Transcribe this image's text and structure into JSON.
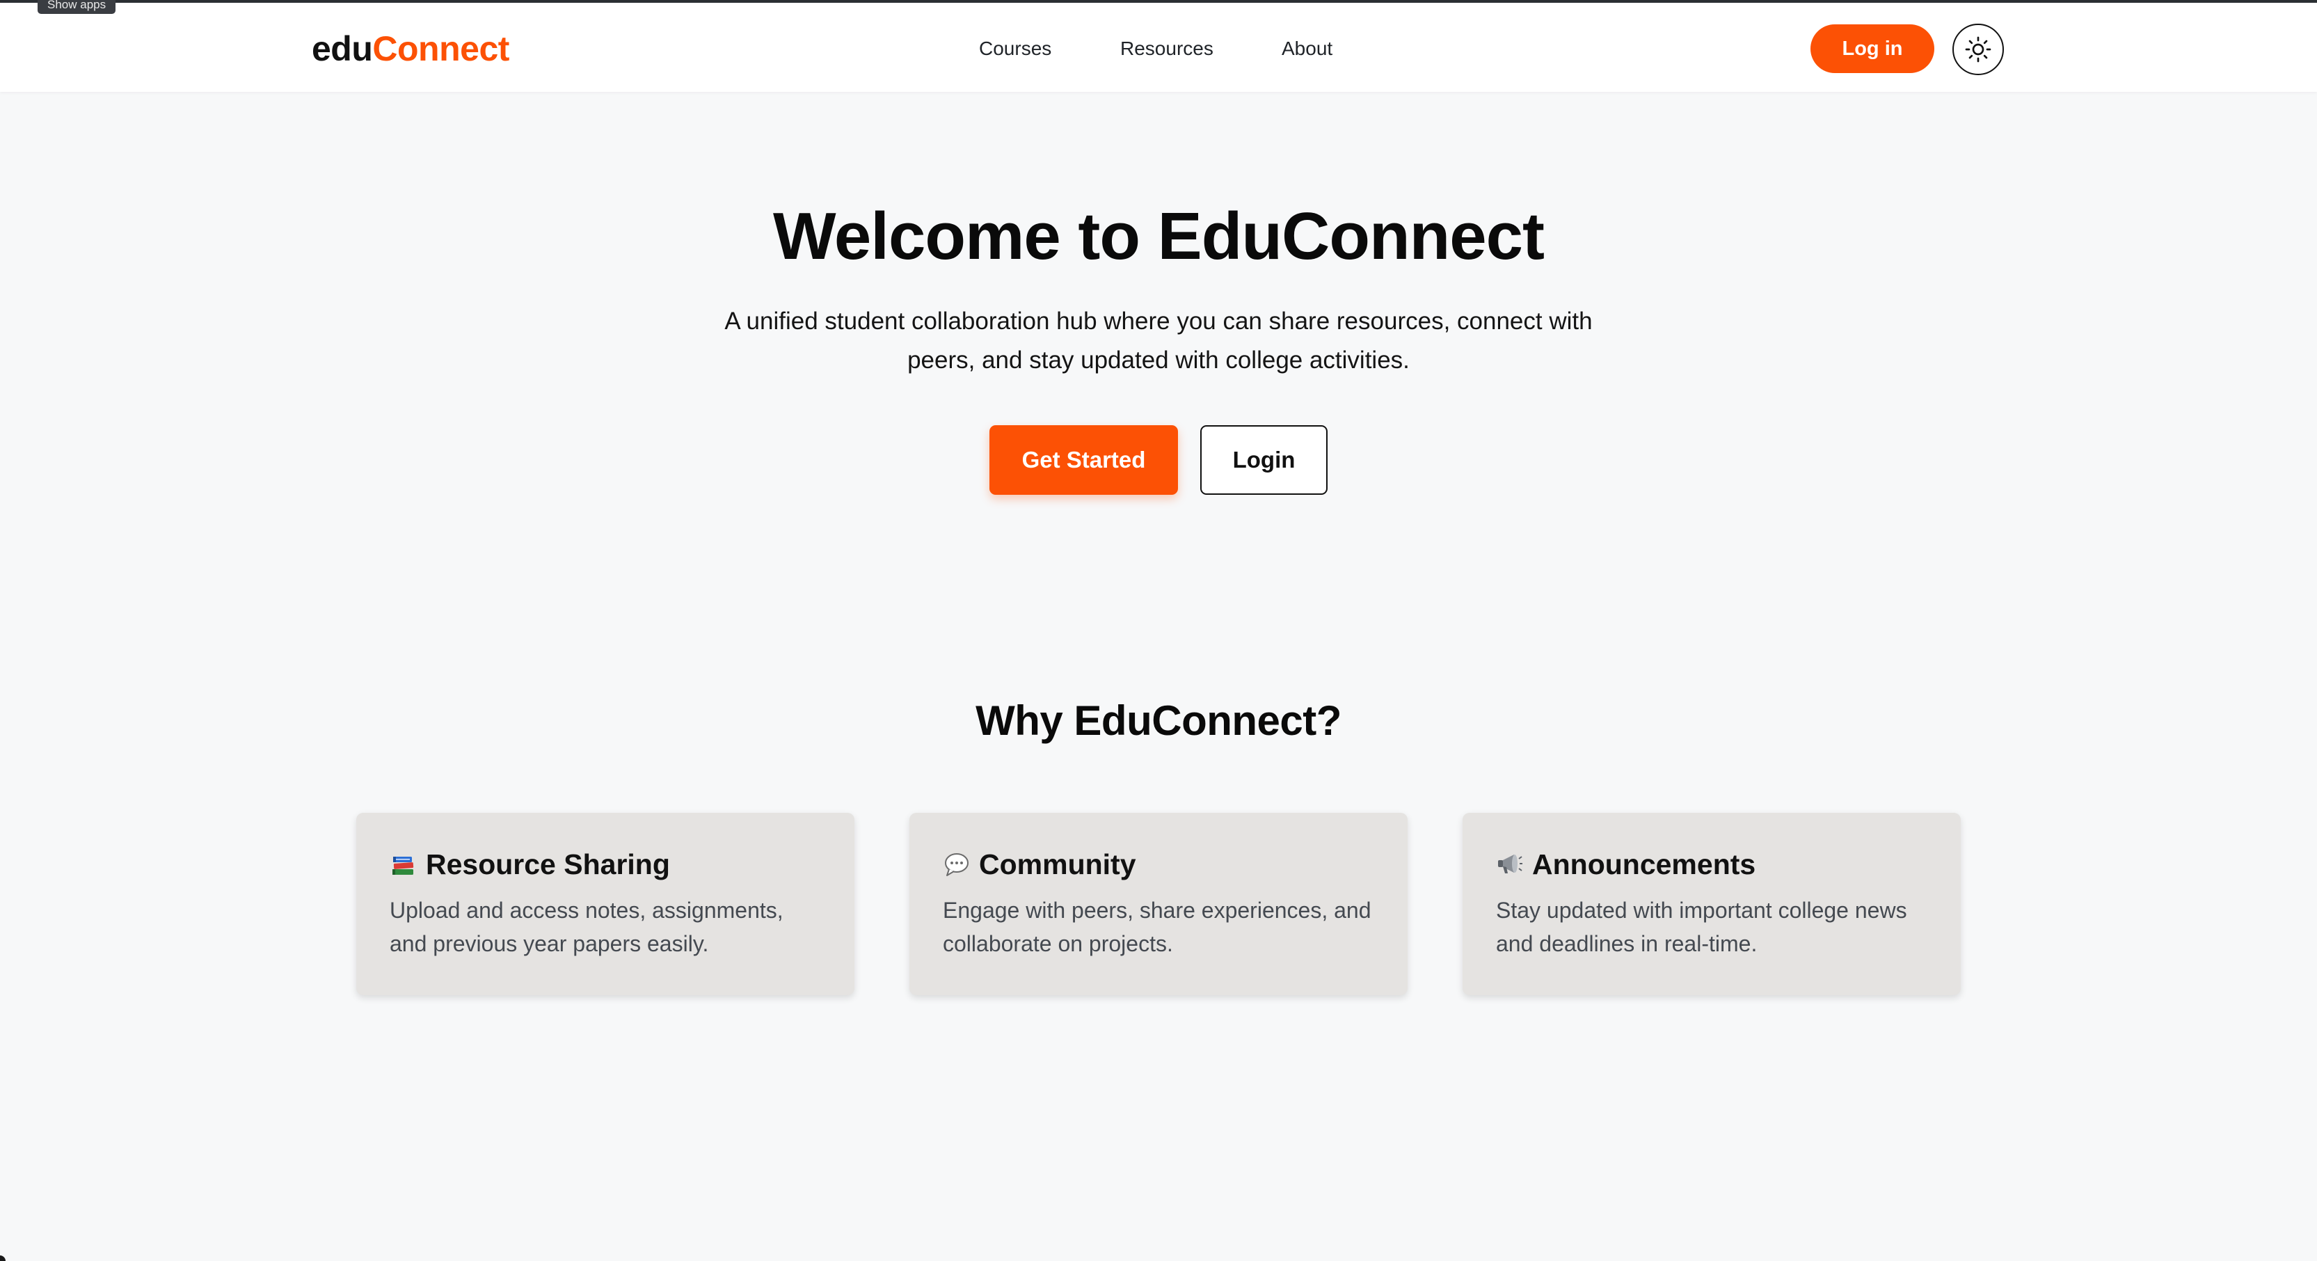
{
  "system": {
    "tooltip": "Show apps"
  },
  "header": {
    "logo_part1": "edu",
    "logo_part2": "Connect",
    "nav": [
      {
        "label": "Courses"
      },
      {
        "label": "Resources"
      },
      {
        "label": "About"
      }
    ],
    "login_label": "Log in",
    "theme_icon": "sun-icon"
  },
  "hero": {
    "title": "Welcome to EduConnect",
    "subtitle": "A unified student collaboration hub where you can share resources, connect with peers, and stay updated with college activities.",
    "primary_cta": "Get Started",
    "secondary_cta": "Login"
  },
  "features": {
    "heading": "Why EduConnect?",
    "cards": [
      {
        "icon": "books-icon",
        "title": "Resource Sharing",
        "description": "Upload and access notes, assignments, and previous year papers easily."
      },
      {
        "icon": "speech-bubble-icon",
        "title": "Community",
        "description": "Engage with peers, share experiences, and collaborate on projects."
      },
      {
        "icon": "megaphone-icon",
        "title": "Announcements",
        "description": "Stay updated with important college news and deadlines in real-time."
      }
    ]
  },
  "colors": {
    "accent": "#fc5105",
    "page_background": "#f7f8f9",
    "card_background": "#e5e3e1",
    "text_primary": "#111111",
    "text_secondary": "#444950"
  }
}
